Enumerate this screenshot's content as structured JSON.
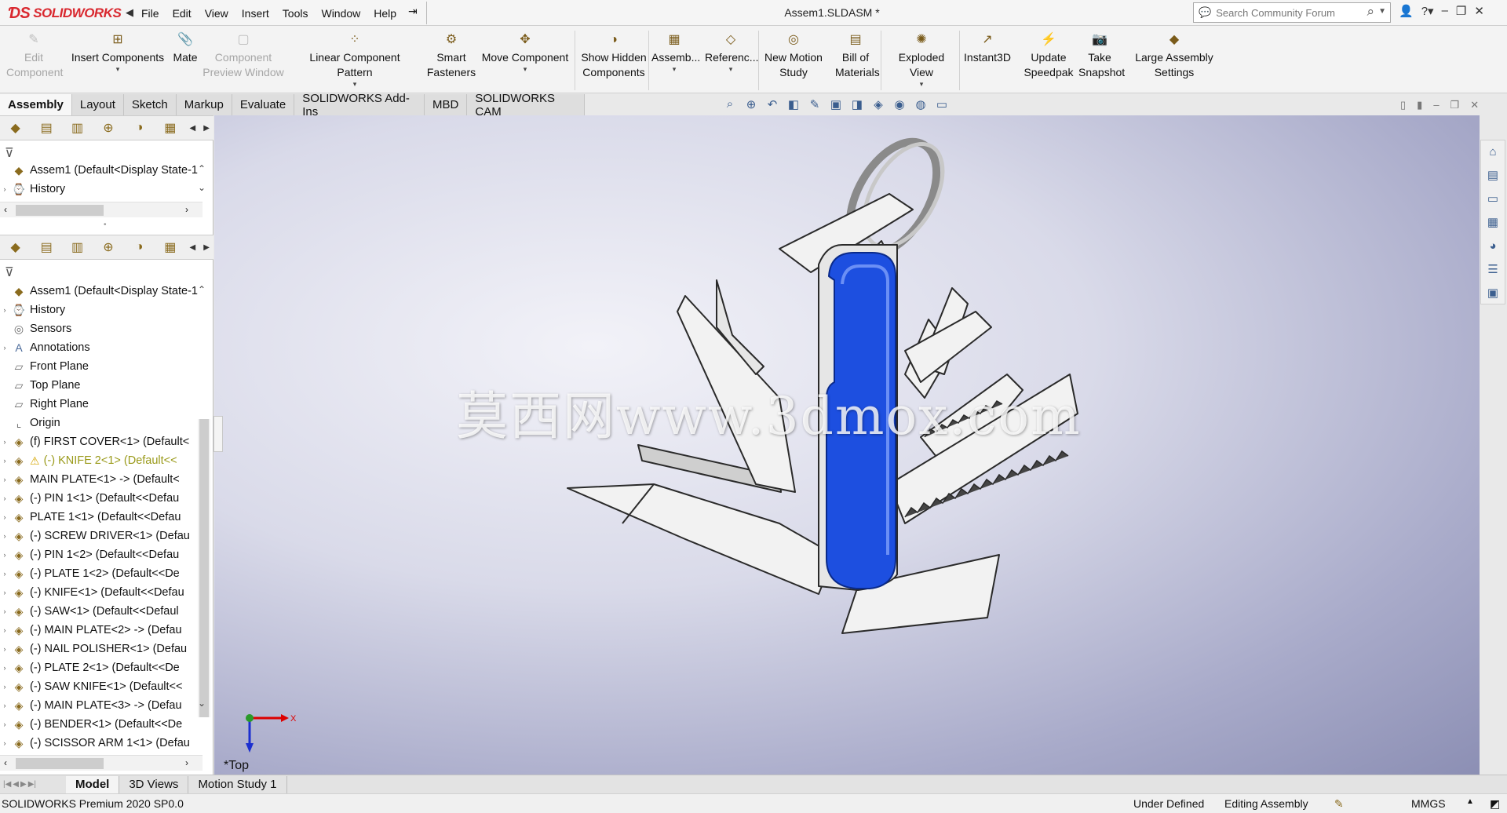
{
  "app": {
    "logo_text": "SOLIDWORKS",
    "document_title": "Assem1.SLDASM *"
  },
  "menu": [
    "File",
    "Edit",
    "View",
    "Insert",
    "Tools",
    "Window",
    "Help"
  ],
  "search": {
    "placeholder": "Search Community Forum"
  },
  "toolbar": [
    {
      "id": "edit-component",
      "label1": "Edit",
      "label2": "Component",
      "disabled": true,
      "icon": "edit-component-icon"
    },
    {
      "id": "insert-components",
      "label1": "Insert Components",
      "label2": "",
      "caret": true,
      "icon": "insert-components-icon"
    },
    {
      "id": "mate",
      "label1": "Mate",
      "label2": "",
      "icon": "paperclip-mate-icon"
    },
    {
      "id": "component-preview",
      "label1": "Component",
      "label2": "Preview Window",
      "disabled": true,
      "icon": "preview-window-icon"
    },
    {
      "id": "linear-pattern",
      "label1": "Linear Component Pattern",
      "label2": "",
      "caret": true,
      "icon": "linear-pattern-icon"
    },
    {
      "id": "smart-fasteners",
      "label1": "Smart",
      "label2": "Fasteners",
      "icon": "smart-fasteners-icon"
    },
    {
      "id": "move-component",
      "label1": "Move Component",
      "label2": "",
      "caret": true,
      "icon": "move-component-icon"
    },
    {
      "id": "show-hidden",
      "label1": "Show Hidden",
      "label2": "Components",
      "icon": "show-hidden-icon"
    },
    {
      "id": "assembly-features",
      "label1": "Assemb...",
      "label2": "",
      "caret": true,
      "icon": "assembly-features-icon"
    },
    {
      "id": "reference-geometry",
      "label1": "Referenc...",
      "label2": "",
      "caret": true,
      "icon": "reference-geometry-icon"
    },
    {
      "id": "new-motion-study",
      "label1": "New Motion",
      "label2": "Study",
      "icon": "motion-study-icon"
    },
    {
      "id": "bill-of-materials",
      "label1": "Bill of",
      "label2": "Materials",
      "icon": "bom-icon"
    },
    {
      "id": "exploded-view",
      "label1": "Exploded View",
      "label2": "",
      "caret": true,
      "icon": "exploded-view-icon"
    },
    {
      "id": "instant3d",
      "label1": "Instant3D",
      "label2": "",
      "icon": "instant3d-icon"
    },
    {
      "id": "update-speedpak",
      "label1": "Update",
      "label2": "Speedpak",
      "icon": "speedpak-icon"
    },
    {
      "id": "take-snapshot",
      "label1": "Take",
      "label2": "Snapshot",
      "icon": "camera-icon"
    },
    {
      "id": "large-assembly",
      "label1": "Large Assembly",
      "label2": "Settings",
      "icon": "large-assembly-icon"
    }
  ],
  "tabs": [
    "Assembly",
    "Layout",
    "Sketch",
    "Markup",
    "Evaluate",
    "SOLIDWORKS Add-Ins",
    "MBD",
    "SOLIDWORKS CAM"
  ],
  "tree_top": [
    {
      "label": "Assem1  (Default<Display State-1",
      "type": "root"
    },
    {
      "label": "History",
      "type": "history"
    }
  ],
  "tree_main": [
    {
      "label": "Assem1  (Default<Display State-1",
      "type": "root",
      "exp": false
    },
    {
      "label": "History",
      "type": "history",
      "exp": true
    },
    {
      "label": "Sensors",
      "type": "sensor",
      "exp": false
    },
    {
      "label": "Annotations",
      "type": "annot",
      "exp": true
    },
    {
      "label": "Front Plane",
      "type": "plane",
      "exp": false
    },
    {
      "label": "Top Plane",
      "type": "plane",
      "exp": false
    },
    {
      "label": "Right Plane",
      "type": "plane",
      "exp": false
    },
    {
      "label": "Origin",
      "type": "origin",
      "exp": false
    },
    {
      "label": "(f) FIRST COVER<1> (Default<",
      "type": "part",
      "exp": true
    },
    {
      "label": "(-) KNIFE 2<1> (Default<<",
      "type": "part",
      "exp": true,
      "warn": true
    },
    {
      "label": "MAIN PLATE<1> -> (Default<",
      "type": "part",
      "exp": true
    },
    {
      "label": "(-) PIN 1<1> (Default<<Defau",
      "type": "part",
      "exp": true
    },
    {
      "label": "PLATE 1<1> (Default<<Defau",
      "type": "part",
      "exp": true
    },
    {
      "label": "(-) SCREW DRIVER<1> (Defau",
      "type": "part",
      "exp": true
    },
    {
      "label": "(-) PIN 1<2> (Default<<Defau",
      "type": "part",
      "exp": true
    },
    {
      "label": "(-) PLATE 1<2> (Default<<De",
      "type": "part",
      "exp": true
    },
    {
      "label": "(-) KNIFE<1> (Default<<Defau",
      "type": "part",
      "exp": true
    },
    {
      "label": "(-) SAW<1> (Default<<Defaul",
      "type": "part",
      "exp": true
    },
    {
      "label": "(-) MAIN PLATE<2> -> (Defau",
      "type": "part",
      "exp": true
    },
    {
      "label": "(-) NAIL POLISHER<1> (Defau",
      "type": "part",
      "exp": true
    },
    {
      "label": "(-) PLATE 2<1> (Default<<De",
      "type": "part",
      "exp": true
    },
    {
      "label": "(-) SAW KNIFE<1> (Default<<",
      "type": "part",
      "exp": true
    },
    {
      "label": "(-) MAIN PLATE<3> -> (Defau",
      "type": "part",
      "exp": true
    },
    {
      "label": "(-) BENDER<1> (Default<<De",
      "type": "part",
      "exp": true
    },
    {
      "label": "(-) SCISSOR ARM 1<1> (Defau",
      "type": "part",
      "exp": true
    }
  ],
  "viewport": {
    "watermark": "莫西网www.3dmox.com",
    "view_label": "*Top",
    "triad_x": "X"
  },
  "bottom_tabs": [
    "Model",
    "3D Views",
    "Motion Study 1"
  ],
  "status": {
    "version": "SOLIDWORKS Premium 2020 SP0.0",
    "definition": "Under Defined",
    "mode": "Editing Assembly",
    "units": "MMGS"
  },
  "colors": {
    "handle": "#1d4fe0",
    "accent": "#d9282f"
  }
}
